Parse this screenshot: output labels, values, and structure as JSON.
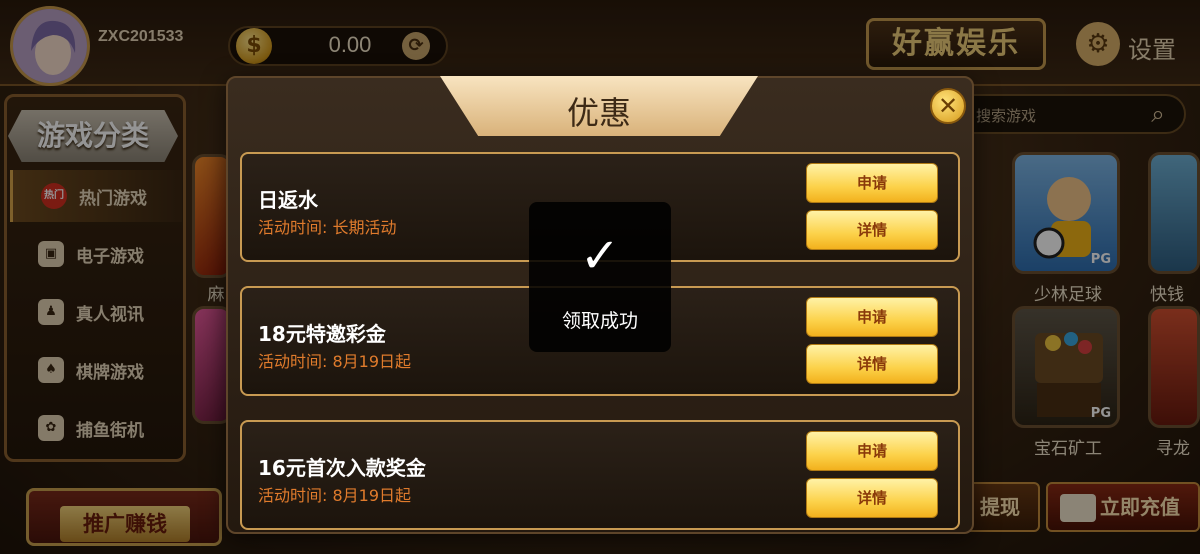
{
  "header": {
    "username": "ZXC201533",
    "balance": "0.00",
    "coin_symbol": "$",
    "brand": "好赢娱乐",
    "settings_label": "设置"
  },
  "sidebar": {
    "title": "游戏分类",
    "items": [
      {
        "label": "热门游戏",
        "icon": "hot-badge-icon",
        "badge": "热门"
      },
      {
        "label": "电子游戏",
        "icon": "slot-machine-icon"
      },
      {
        "label": "真人视讯",
        "icon": "live-dealer-icon"
      },
      {
        "label": "棋牌游戏",
        "icon": "cards-icon"
      },
      {
        "label": "捕鱼街机",
        "icon": "fish-icon"
      }
    ]
  },
  "promo_footer": {
    "label": "推广赚钱"
  },
  "search": {
    "placeholder": "搜索游戏"
  },
  "games": [
    {
      "title": "少林足球",
      "provider": "PG"
    },
    {
      "title": "快钱",
      "provider": ""
    },
    {
      "title": "宝石矿工",
      "provider": "PG"
    },
    {
      "title": "寻龙",
      "provider": ""
    },
    {
      "title": "麻",
      "provider": ""
    }
  ],
  "footer": {
    "withdraw_label": "提现",
    "recharge_label": "立即充值"
  },
  "modal": {
    "title": "优惠",
    "close_symbol": "✕",
    "promotions": [
      {
        "name": "日返水",
        "time": "活动时间: 长期活动",
        "apply_label": "申请",
        "detail_label": "详情"
      },
      {
        "name": "18元特邀彩金",
        "time": "活动时间: 8月19日起",
        "apply_label": "申请",
        "detail_label": "详情"
      },
      {
        "name": "16元首次入款奖金",
        "time": "活动时间: 8月19日起",
        "apply_label": "申请",
        "detail_label": "详情"
      }
    ]
  },
  "toast": {
    "check": "✓",
    "message": "领取成功"
  }
}
